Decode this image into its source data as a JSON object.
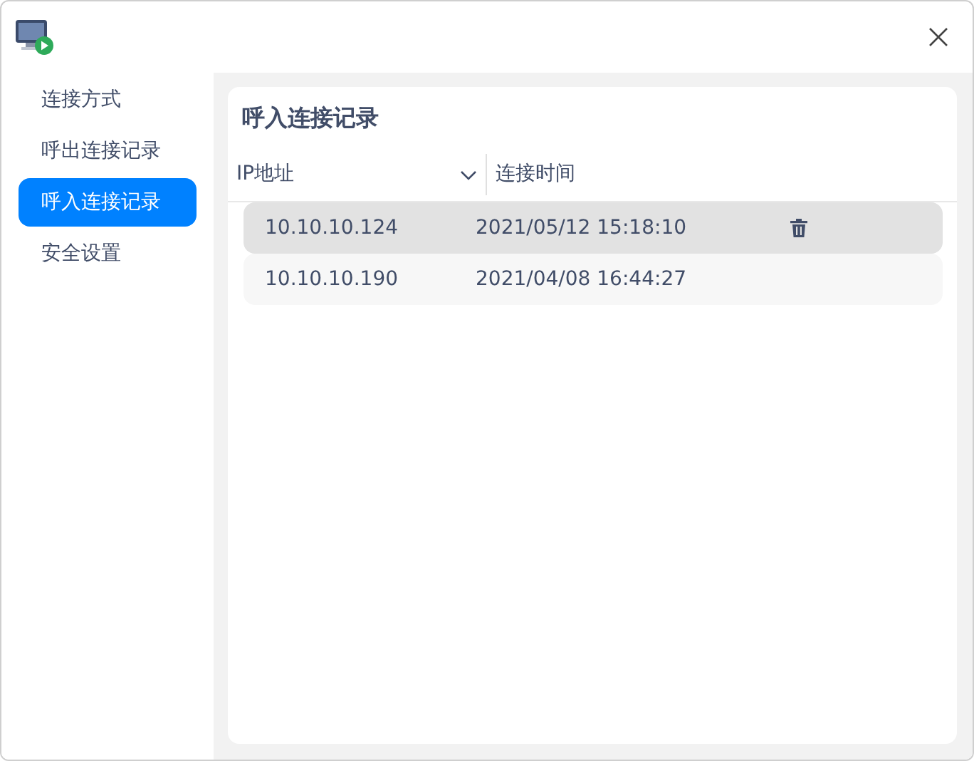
{
  "sidebar": {
    "items": [
      {
        "label": "连接方式",
        "selected": false
      },
      {
        "label": "呼出连接记录",
        "selected": false
      },
      {
        "label": "呼入连接记录",
        "selected": true
      },
      {
        "label": "安全设置",
        "selected": false
      }
    ]
  },
  "panel": {
    "title": "呼入连接记录",
    "table": {
      "columns": [
        {
          "label": "IP地址",
          "sorted": true
        },
        {
          "label": "连接时间",
          "sorted": false
        }
      ],
      "rows": [
        {
          "ip": "10.10.10.124",
          "time": "2021/05/12 15:18:10",
          "hovered": true
        },
        {
          "ip": "10.10.10.190",
          "time": "2021/04/08 16:44:27",
          "hovered": false
        }
      ]
    }
  }
}
